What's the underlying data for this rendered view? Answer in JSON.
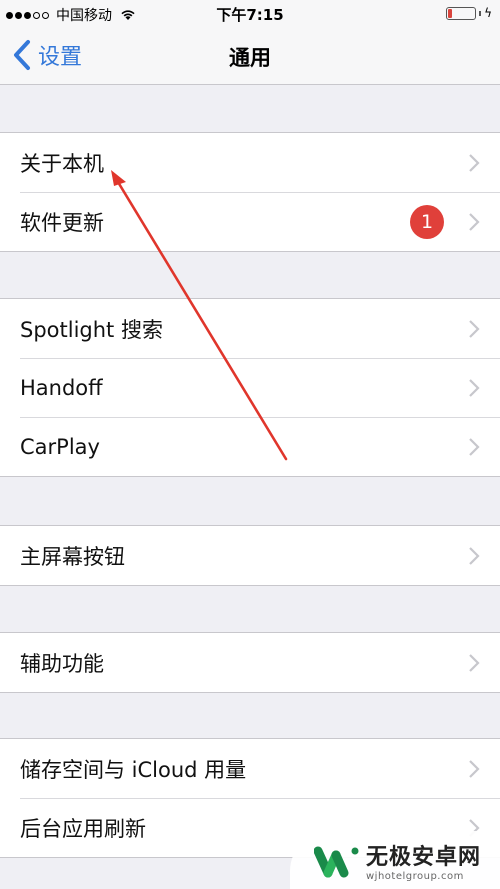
{
  "status_bar": {
    "signal_strength": "3/5",
    "carrier": "中国移动",
    "time": "下午7:15",
    "battery_level": "low",
    "charging": true,
    "colors": {
      "battery_low": "#d9443c"
    }
  },
  "nav": {
    "back_label": "设置",
    "title": "通用",
    "colors": {
      "tint": "#3478d9"
    }
  },
  "groups": [
    {
      "items": [
        {
          "label": "关于本机"
        },
        {
          "label": "软件更新",
          "badge": "1"
        }
      ]
    },
    {
      "items": [
        {
          "label": "Spotlight 搜索"
        },
        {
          "label": "Handoff"
        },
        {
          "label": "CarPlay"
        }
      ]
    },
    {
      "items": [
        {
          "label": "主屏幕按钮"
        }
      ]
    },
    {
      "items": [
        {
          "label": "辅助功能"
        }
      ]
    },
    {
      "items": [
        {
          "label": "储存空间与 iCloud 用量"
        },
        {
          "label": "后台应用刷新"
        }
      ]
    }
  ],
  "annotation": {
    "type": "arrow",
    "points_to": "关于本机",
    "color": "#e0362c"
  },
  "watermark": {
    "name": "无极安卓网",
    "url": "wjhotelgroup.com",
    "colors": {
      "logo_dark": "#1a8a4a",
      "logo_light": "#2bb35c"
    }
  }
}
